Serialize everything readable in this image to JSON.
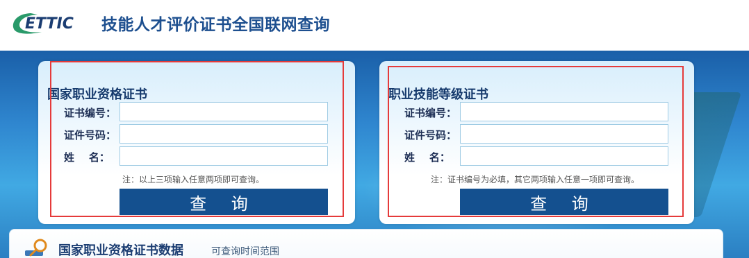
{
  "header": {
    "logo_text": "ETTIC",
    "title": "技能人才评价证书全国联网查询"
  },
  "panels": {
    "left": {
      "title": "国家职业资格证书",
      "fields": [
        {
          "label": "证书编号：",
          "value": ""
        },
        {
          "label": "证件号码：",
          "value": ""
        },
        {
          "label": "姓    名：",
          "value": ""
        }
      ],
      "note": "注：以上三项输入任意两项即可查询。",
      "button_label": "查 询"
    },
    "right": {
      "title": "职业技能等级证书",
      "fields": [
        {
          "label": "证书编号：",
          "value": ""
        },
        {
          "label": "证件号码：",
          "value": ""
        },
        {
          "label": "姓    名：",
          "value": ""
        }
      ],
      "note": "注：证书编号为必填，其它两项输入任意一项即可查询。",
      "button_label": "查 询"
    }
  },
  "section": {
    "title": "国家职业资格证书数据",
    "subtitle": "可查询时间范围",
    "icon": "search-magnifier-icon"
  },
  "colors": {
    "brand_blue": "#1d4f8f",
    "button_blue": "#14508f",
    "logo_green": "#2a9a6a",
    "highlight_red": "#e53a3a"
  }
}
